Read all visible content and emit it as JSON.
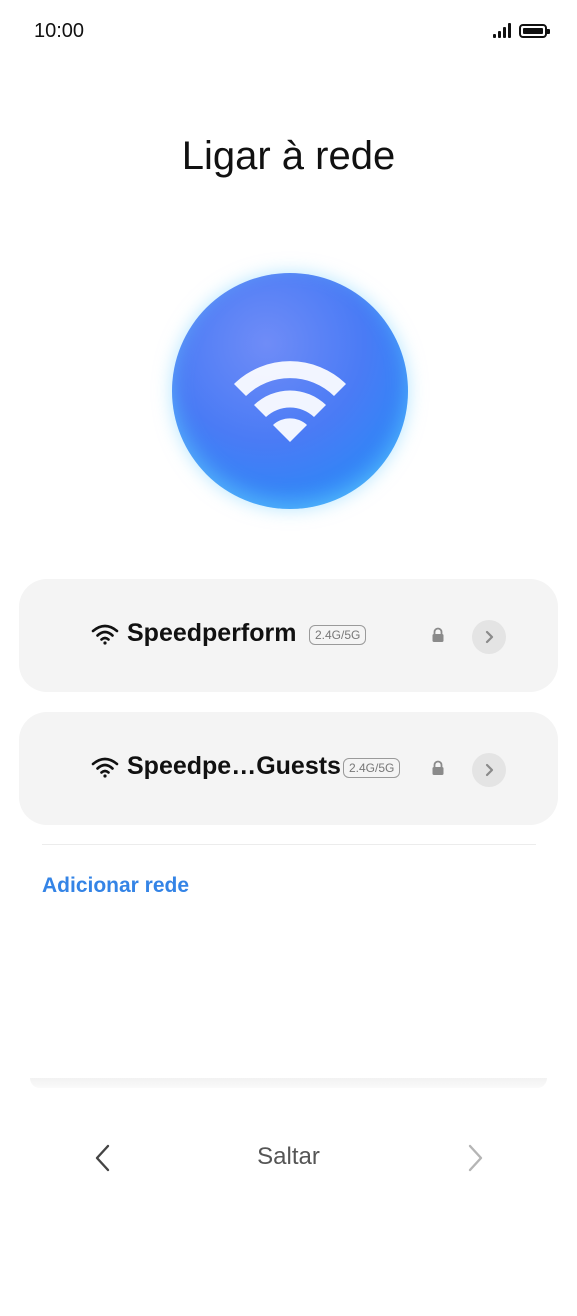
{
  "status_bar": {
    "time": "10:00"
  },
  "title": "Ligar à rede",
  "networks": [
    {
      "ssid": "Speedperform",
      "band": "2.4G/5G"
    },
    {
      "ssid": "Speedpe…Guests",
      "band": "2.4G/5G"
    }
  ],
  "add_network_label": "Adicionar rede",
  "footer": {
    "skip_label": "Saltar"
  },
  "colors": {
    "accent": "#3484e6",
    "card_bg": "#f4f4f4",
    "hero_blue": "#4a7bf5"
  },
  "icons": [
    "signal-icon",
    "battery-icon",
    "wifi-icon",
    "lock-icon",
    "chevron-right-icon",
    "chevron-left-icon"
  ]
}
